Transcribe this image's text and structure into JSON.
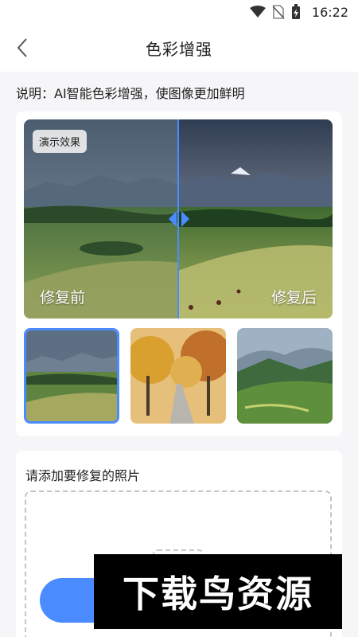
{
  "status_bar": {
    "time": "16:22",
    "icons": [
      "wifi-icon",
      "no-sim-icon",
      "battery-charging-icon"
    ]
  },
  "header": {
    "title": "色彩增强",
    "back_icon": "chevron-left-icon"
  },
  "description": "说明：AI智能色彩增强，使图像更加鲜明",
  "demo": {
    "tag": "演示效果",
    "before_label": "修复前",
    "after_label": "修复后",
    "thumbnails": [
      {
        "name": "grassland-mountains",
        "selected": true
      },
      {
        "name": "autumn-tree-road",
        "selected": false
      },
      {
        "name": "green-mountain-valley",
        "selected": false
      }
    ]
  },
  "upload": {
    "title": "请添加要修复的照片"
  },
  "watermark": {
    "text": "下载鸟资源"
  },
  "colors": {
    "accent": "#4a8cff",
    "background": "#f6f6f8",
    "card": "#ffffff"
  }
}
